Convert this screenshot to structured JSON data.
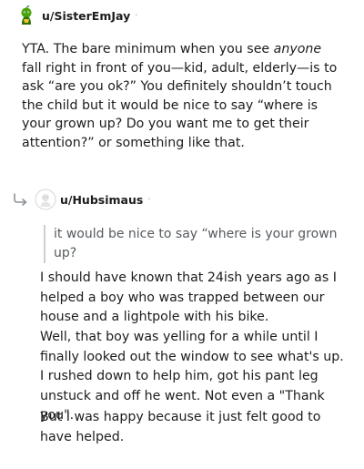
{
  "comment1": {
    "avatar_icon": "snoo-green-avatar-icon",
    "username": "u/SisterEmJay",
    "separator": "·",
    "body_before_em": "YTA. The bare minimum when you see ",
    "body_em": "anyone",
    "body_after_em": " fall right in front of you—kid, adult, elderly—is to ask “are you ok?” You definitely shouldn’t touch the child but it would be nice to say “where is your grown up? Do you want me to get their attention?” or something like that."
  },
  "comment2": {
    "reply_icon": "reply-arrow-icon",
    "avatar_icon": "default-avatar-icon",
    "username": "u/Hubsimaus",
    "separator": "·",
    "quote": "it would be nice to say “where is your grown up?",
    "paragraphs": [
      "I should have known that 24ish years ago as I helped a boy who was trapped between our house and a lightpole with his bike.",
      "Well, that boy was yelling for a while until I finally looked out the window to see what's up. I rushed down to help him, got his pant leg unstuck and off he went. Not even a \"Thank you\".",
      "But I was happy because it just felt good to have helped."
    ]
  },
  "colors": {
    "text": "#1c1c1c",
    "quote_text": "#555a5e",
    "quote_bar": "#cfcfcf",
    "avatar_green": "#46a508"
  }
}
